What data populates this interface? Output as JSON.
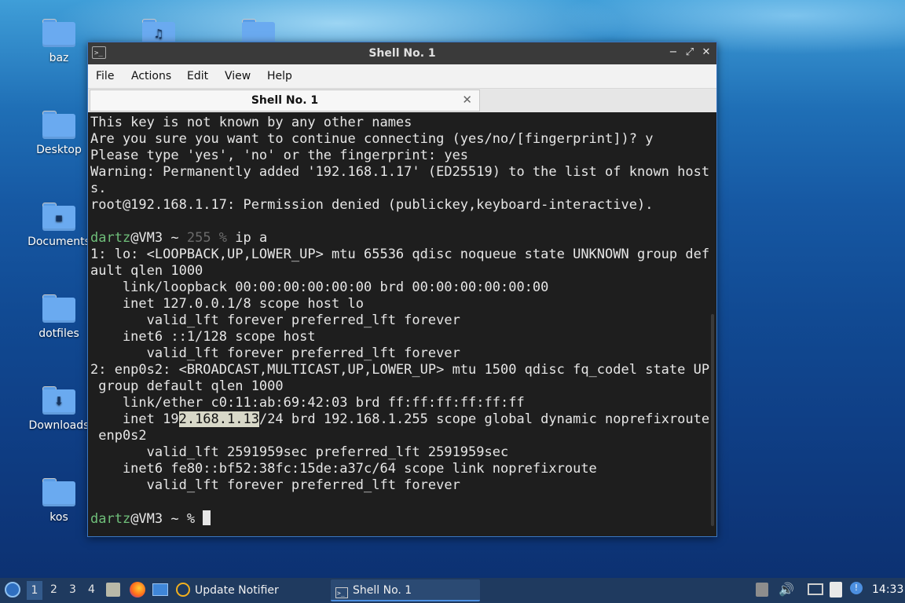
{
  "desktop": {
    "icons": [
      {
        "label": "baz",
        "glyph": ""
      },
      {
        "label": "",
        "glyph": "♫"
      },
      {
        "label": "",
        "glyph": ""
      },
      {
        "label": "Desktop",
        "glyph": ""
      },
      {
        "label": "Documents",
        "glyph": "▪"
      },
      {
        "label": "dotfiles",
        "glyph": ""
      },
      {
        "label": "Downloads",
        "glyph": "⬇"
      },
      {
        "label": "kos",
        "glyph": ""
      }
    ]
  },
  "window": {
    "title": "Shell No. 1",
    "menu": [
      "File",
      "Actions",
      "Edit",
      "View",
      "Help"
    ],
    "tab_label": "Shell No. 1",
    "tab_close": "✕",
    "buttons": {
      "minimize": "−",
      "maximize": "⤢",
      "close": "✕"
    }
  },
  "terminal": {
    "lines": [
      "This key is not known by any other names",
      "Are you sure you want to continue connecting (yes/no/[fingerprint])? y",
      "Please type 'yes', 'no' or the fingerprint: yes",
      "Warning: Permanently added '192.168.1.17' (ED25519) to the list of known host",
      "s.",
      "root@192.168.1.17: Permission denied (publickey,keyboard-interactive).",
      "",
      "",
      "1: lo: <LOOPBACK,UP,LOWER_UP> mtu 65536 qdisc noqueue state UNKNOWN group def",
      "ault qlen 1000",
      "    link/loopback 00:00:00:00:00:00 brd 00:00:00:00:00:00",
      "    inet 127.0.0.1/8 scope host lo",
      "       valid_lft forever preferred_lft forever",
      "    inet6 ::1/128 scope host",
      "       valid_lft forever preferred_lft forever",
      "2: enp0s2: <BROADCAST,MULTICAST,UP,LOWER_UP> mtu 1500 qdisc fq_codel state UP",
      " group default qlen 1000",
      "    link/ether c0:11:ab:69:42:03 brd ff:ff:ff:ff:ff:ff",
      "",
      " enp0s2",
      "       valid_lft 2591959sec preferred_lft 2591959sec",
      "    inet6 fe80::bf52:38fc:15de:a37c/64 scope link noprefixroute",
      "       valid_lft forever preferred_lft forever",
      ""
    ],
    "prompt1": {
      "user": "dartz",
      "host": "@VM3 ~ ",
      "code": "255 %",
      "cmd": " ip a"
    },
    "inet_line": {
      "pre": "    inet 19",
      "selected": "2.168.1.13",
      "post": "/24 brd 192.168.1.255 scope global dynamic noprefixroute"
    },
    "prompt2": {
      "user": "dartz",
      "host": "@VM3 ~ % "
    }
  },
  "taskbar": {
    "workspaces": [
      "1",
      "2",
      "3",
      "4"
    ],
    "apps": [
      {
        "label": "Update Notifier"
      },
      {
        "label": "Shell No. 1"
      }
    ],
    "clock": "14:33"
  }
}
